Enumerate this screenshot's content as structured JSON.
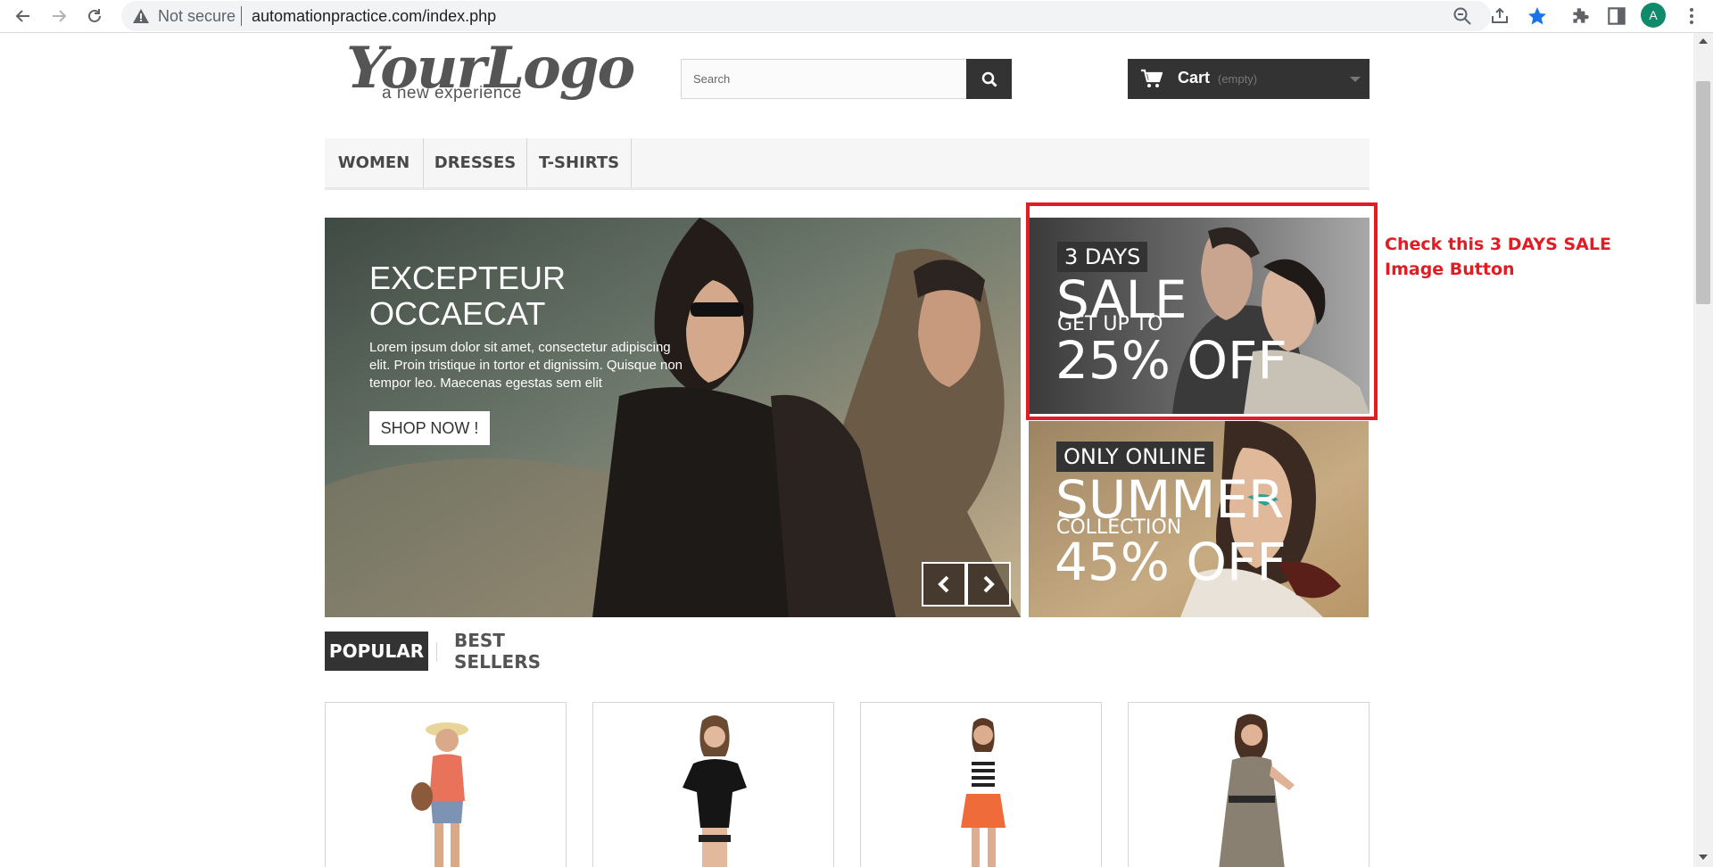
{
  "browser": {
    "security_label": "Not secure",
    "url": "automationpractice.com/index.php",
    "profile_initial": "A"
  },
  "header": {
    "logo_main": "YourLogo",
    "logo_sub": "a new experience",
    "search_placeholder": "Search",
    "cart_label": "Cart",
    "cart_status": "(empty)"
  },
  "menu": {
    "items": [
      {
        "label": "WOMEN"
      },
      {
        "label": "DRESSES"
      },
      {
        "label": "T-SHIRTS"
      }
    ]
  },
  "slider": {
    "title": "EXCEPTEUR OCCAECAT",
    "text": "Lorem ipsum dolor sit amet, consectetur adipiscing elit. Proin tristique in tortor et dignissim. Quisque non tempor leo. Maecenas egestas sem elit",
    "button": "SHOP NOW !"
  },
  "banners": {
    "sale": {
      "badge": "3 DAYS",
      "headline": "SALE",
      "subline": "GET UP TO",
      "offer": "25% OFF"
    },
    "online": {
      "badge": "ONLY ONLINE",
      "headline": "SUMMER",
      "subline": "COLLECTION",
      "offer": "45% OFF"
    }
  },
  "annotation": {
    "text": "Check this 3 DAYS SALE Image Button",
    "color": "#e31b23"
  },
  "tabs": {
    "active": "POPULAR",
    "inactive": "BEST SELLERS"
  },
  "colors": {
    "dark": "#333333",
    "menu_bg": "#f6f6f6",
    "highlight": "#e31b23"
  }
}
